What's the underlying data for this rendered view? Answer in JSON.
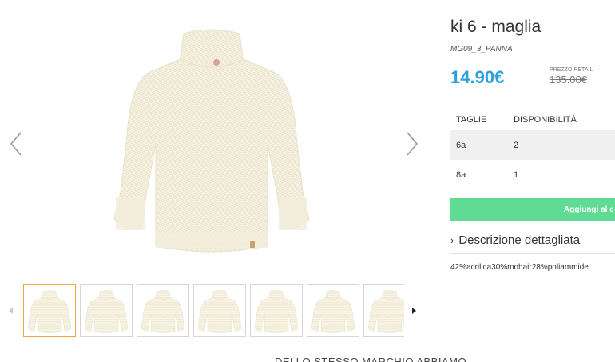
{
  "product": {
    "title": "ki 6 - maglia",
    "sku": "MG09_3_PANNA",
    "price": "14.90€",
    "retail_label": "PREZZO RETAIL",
    "retail_price": "135.00€"
  },
  "sizes_table": {
    "headers": [
      "TAGLIE",
      "DISPONIBILITÀ"
    ],
    "rows": [
      {
        "size": "6a",
        "availability": "2"
      },
      {
        "size": "8a",
        "availability": "1"
      }
    ]
  },
  "add_to_cart_label": "Aggiungi al c",
  "description": {
    "toggle_label": "Descrizione dettagliata",
    "composition": "42%acrilica30%mohair28%poliammide"
  },
  "gallery": {
    "thumbnail_count": 7,
    "active_thumbnail": 1
  },
  "bottom_heading": "DELLO STESSO MARCHIO ABBIAMO",
  "colors": {
    "price": "#2d9fe0",
    "add_to_cart": "#5fdb93",
    "active_thumb_border": "#f0a640",
    "sweater": "#f7f3e3"
  },
  "icons": {
    "prev": "chevron-left-icon",
    "next": "chevron-right-icon",
    "thumb_prev": "caret-left-icon",
    "thumb_next": "caret-right-icon",
    "toggle": "chevron-right-icon"
  }
}
